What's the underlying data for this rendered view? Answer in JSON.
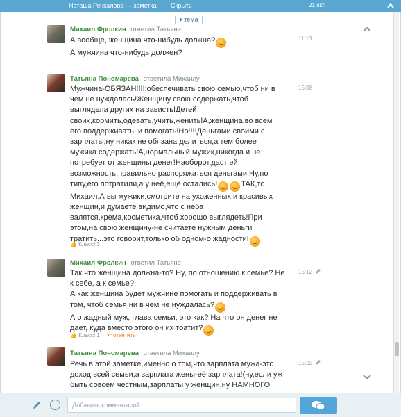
{
  "header": {
    "title": "Наташа Речкалова — заметка",
    "hide_label": "Скрыть",
    "date": "21 окт"
  },
  "topic_tab": "▾ тема",
  "comments": [
    {
      "author": "Михаил Фролкин",
      "replied": "ответил Татьяне",
      "time": "11:13",
      "lines": [
        "А вообще, женщина что-нибудь должна?",
        "А мужчина что-нибудь должен?"
      ]
    },
    {
      "author": "Татьяна Пономарева",
      "replied": "ответила Михаилу",
      "time": "15:08",
      "lines": [
        "Мужчина-ОБЯЗАН!!!!:обеспечивать свою семью,чтоб ни в",
        "чем не нуждалась!Женщину свою содержать,чтоб",
        "выглядела других на зависть!Детей",
        "своих,кормить,одевать,учить,женить!А,женщина,во всем",
        "его поддерживать..и помогать!Но!!!!Деньгами своими с",
        "зарплаты,ну никак не обязана делиться,а тем более",
        "мужика содержать!А,нормальный мужик,никогда и не",
        "потребует от женщины денег!Наоборот,даст ей",
        "возможность,правильно распоряжаться деньгами!Ну,по",
        "типу,его потратили,а у неё,ещё остались!",
        "Михаил.А вы мужики,смотрите на ухоженных и красивых",
        "женщин,и думаете видимо,что с неба",
        "валятся,крема,косметика,чтоб хорошо выглядеть!При",
        "этом,на свою женщину-не считаете нужным деньги",
        "тратить...это говорит,только об одном-о жадности!"
      ],
      "tak_text": "ТАК,то",
      "klass": "Класс! 3"
    },
    {
      "author": "Михаил Фролкин",
      "replied": "ответил Татьяне",
      "time": "15:12",
      "lines": [
        "Так что женщина должна-то? Ну, по отношению к семье? Не",
        "к себе, а к семье?",
        "А как женщина будет мужчине помогать и поддерживать в",
        "том, чтоб семья ни в чем не нуждалась?",
        "А о жадный муж, глава семьи, это как? На что он денег не",
        "дает, куда вместо этого он их тоатит?"
      ],
      "klass": "Класс! 1",
      "reply": "ответить"
    },
    {
      "author": "Татьяна Пономарева",
      "replied": "ответила Михаилу",
      "time": "15:22",
      "lines": [
        "Речь в этой заметке,именно о том,что зарплата мужа-это",
        "доход всей семьи,а зарплата жены-её зарплата!(ну,если уж",
        "быть совсем честным,зарплаты у женщин,ну НАМНОГО"
      ]
    }
  ],
  "composer": {
    "placeholder": "Добавить комментарий"
  },
  "colors": {
    "header_bg": "#5aa8d2",
    "author": "#3e8e3b",
    "accent": "#e57b12",
    "send_button": "#54a6d8"
  }
}
